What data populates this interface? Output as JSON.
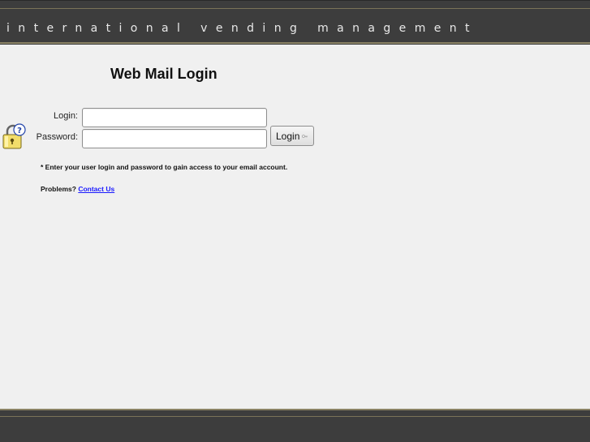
{
  "header": {
    "brand": "international vending management"
  },
  "main": {
    "title": "Web Mail Login",
    "login_label": "Login:",
    "password_label": "Password:",
    "login_value": "",
    "password_value": "",
    "login_button": "Login",
    "note": "* Enter your user login and password to gain access to your email account.",
    "problems_text": "Problems?",
    "contact_link": "Contact Us"
  },
  "icons": {
    "lock": "lock-help-icon",
    "key": "key-icon"
  },
  "colors": {
    "header_bg": "#3d3d3d",
    "accent_line": "#8a8264",
    "link": "#1a1aff"
  }
}
